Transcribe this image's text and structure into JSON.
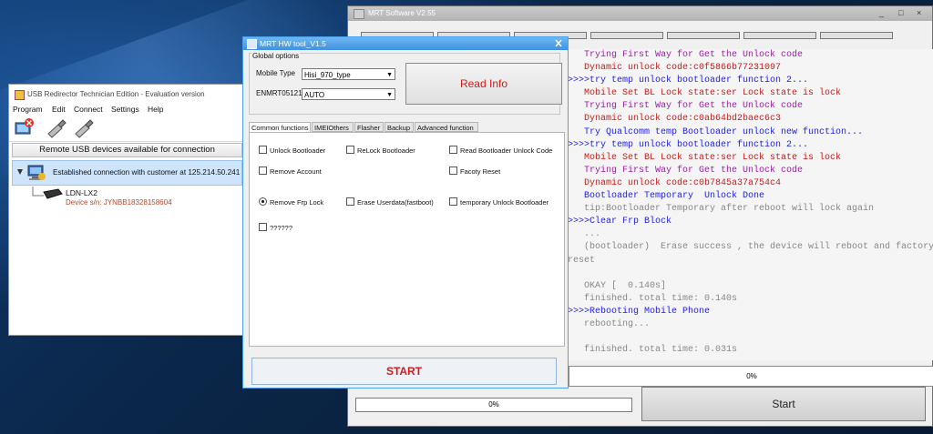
{
  "mrt": {
    "title": "MRT Software V2.55",
    "controls": [
      "_",
      "□",
      "×"
    ],
    "status_percent": "0%",
    "start_label": "Start"
  },
  "log": {
    "lines": [
      {
        "text": "   Trying First Way for Get the Unlock code",
        "color": "purple"
      },
      {
        "text": "   Dynamic unlock code:c0f5866b77231097",
        "color": "red"
      },
      {
        "text": ">>>>try temp unlock bootloader function 2...",
        "color": "blue"
      },
      {
        "text": "   Mobile Set BL Lock state:ser Lock state is lock",
        "color": "red"
      },
      {
        "text": "   Trying First Way for Get the Unlock code",
        "color": "purple"
      },
      {
        "text": "   Dynamic unlock code:c0ab64bd2baec6c3",
        "color": "red"
      },
      {
        "text": "   Try Qualcomm temp Bootloader unlock new function...",
        "color": "blue"
      },
      {
        "text": ">>>>try temp unlock bootloader function 2...",
        "color": "blue"
      },
      {
        "text": "   Mobile Set BL Lock state:ser Lock state is lock",
        "color": "red"
      },
      {
        "text": "   Trying First Way for Get the Unlock code",
        "color": "purple"
      },
      {
        "text": "   Dynamic unlock code:c0b7845a37a754c4",
        "color": "red"
      },
      {
        "text": "   Bootloader Temporary  Unlock Done",
        "color": "blue"
      },
      {
        "text": "   tip:Bootloader Temporary after reboot will lock again",
        "color": "gray"
      },
      {
        "text": ">>>>Clear Frp Block",
        "color": "blue"
      },
      {
        "text": "   ...",
        "color": "gray"
      },
      {
        "text": "   (bootloader)  Erase success , the device will reboot and factory",
        "color": "gray"
      },
      {
        "text": "reset",
        "color": "gray"
      },
      {
        "text": "",
        "color": "gray"
      },
      {
        "text": "   OKAY [  0.140s]",
        "color": "gray"
      },
      {
        "text": "   finished. total time: 0.140s",
        "color": "gray"
      },
      {
        "text": ">>>>Rebooting Mobile Phone",
        "color": "blue"
      },
      {
        "text": "   rebooting...",
        "color": "gray"
      },
      {
        "text": "",
        "color": "gray"
      },
      {
        "text": "   finished. total time: 0.031s",
        "color": "gray"
      }
    ],
    "status_percent": "0%"
  },
  "usb": {
    "title": "USB Redirector Technician Edition - Evaluation version",
    "menu": [
      "Program",
      "Edit",
      "Connect",
      "Settings",
      "Help"
    ],
    "toolbar_icons": [
      "disconnect-icon",
      "usb-plug-icon",
      "usb-plug-icon"
    ],
    "header": "Remote USB devices available for connection",
    "connection": "Established connection with customer at 125.214.50.241",
    "device_name": "LDN-LX2",
    "device_sn": "Device s/n: JYNBB18328158604"
  },
  "hw": {
    "title": "MRT HW tool_V1.5",
    "global_legend": "Global options",
    "mobile_type_label": "Mobile Type",
    "mobile_type_value": "Hisi_970_type",
    "port_label": "ENMRT05121",
    "port_value": "AUTO",
    "read_info": "Read Info",
    "tabs": [
      "Common functions",
      "IMEIOthers",
      "Flasher",
      "Backup",
      "Advanced function"
    ],
    "options": [
      {
        "label": "Unlock Bootloader",
        "kind": "check"
      },
      {
        "label": "ReLock Bootloader",
        "kind": "check"
      },
      {
        "label": "Read Bootloader Unlock Code",
        "kind": "check"
      },
      {
        "label": "Remove Account",
        "kind": "check"
      },
      {
        "label": "Facoty Reset",
        "kind": "check"
      },
      {
        "label": "Remove Frp Lock",
        "kind": "radio"
      },
      {
        "label": "Erase Userdata(fastboot)",
        "kind": "check"
      },
      {
        "label": "temporary Unlock Bootloader",
        "kind": "check"
      },
      {
        "label": "??????",
        "kind": "check"
      }
    ],
    "start_label": "START"
  }
}
